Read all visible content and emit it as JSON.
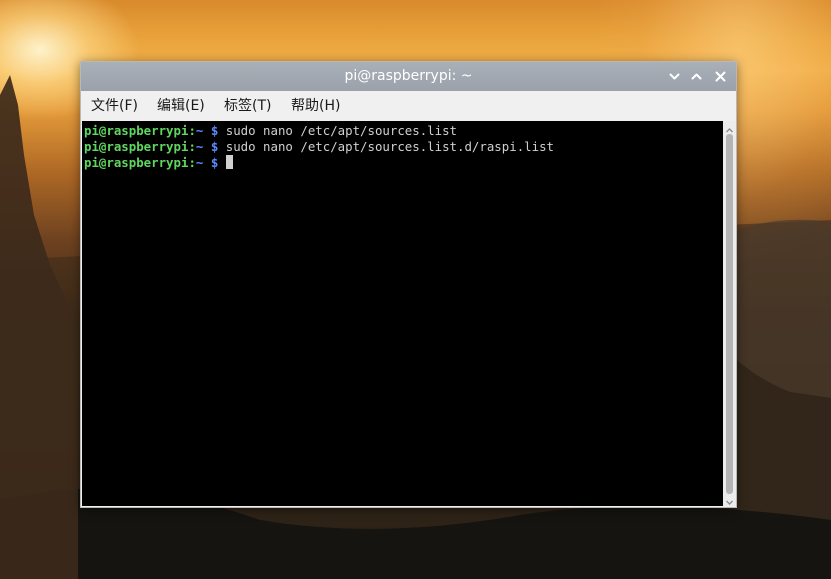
{
  "window": {
    "title": "pi@raspberrypi: ~",
    "controls": {
      "minimize_icon": "chevron-down-icon",
      "maximize_icon": "chevron-up-icon",
      "close_icon": "close-icon"
    }
  },
  "menu": {
    "items": [
      {
        "label": "文件(F)"
      },
      {
        "label": "编辑(E)"
      },
      {
        "label": "标签(T)"
      },
      {
        "label": "帮助(H)"
      }
    ]
  },
  "terminal": {
    "lines": [
      {
        "user_host": "pi@raspberrypi",
        "sep": ":",
        "path": "~ $",
        "command": " sudo nano /etc/apt/sources.list"
      },
      {
        "user_host": "pi@raspberrypi",
        "sep": ":",
        "path": "~ $",
        "command": " sudo nano /etc/apt/sources.list.d/raspi.list"
      },
      {
        "user_host": "pi@raspberrypi",
        "sep": ":",
        "path": "~ $",
        "command": " "
      }
    ]
  },
  "colors": {
    "prompt_user": "#5fd75f",
    "prompt_path": "#5b8cff",
    "terminal_bg": "#000000",
    "terminal_fg": "#d0d0d0",
    "titlebar": "#9aa1aa"
  },
  "scrollbar": {
    "up_icon": "scroll-up-arrow-icon",
    "down_icon": "scroll-down-arrow-icon"
  }
}
